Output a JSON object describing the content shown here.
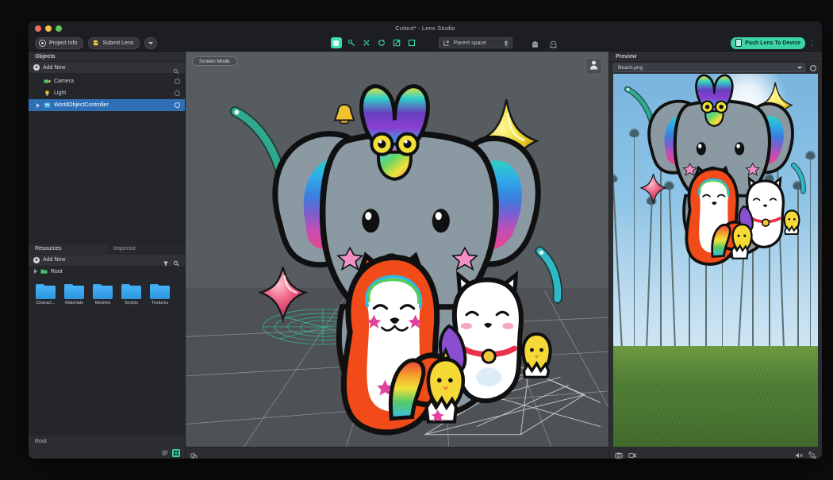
{
  "window": {
    "title": "Cutout* - Lens Studio",
    "traffic_lights": [
      "close",
      "minimize",
      "zoom"
    ]
  },
  "toolbar": {
    "project_info_label": "Project Info",
    "project_info_icon": "lens-studio-logo-icon",
    "submit_lens_label": "Submit Lens",
    "submit_lens_icon": "ghost-icon",
    "submit_caret_icon": "chevron-down-icon",
    "tools": [
      {
        "name": "select-tool",
        "icon": "square-filled-icon",
        "active": true
      },
      {
        "name": "pan-tool",
        "icon": "hand-pan-icon",
        "active": false
      },
      {
        "name": "move-tool",
        "icon": "move-arrows-icon",
        "active": false
      },
      {
        "name": "rotate-tool",
        "icon": "rotate-icon",
        "active": false
      },
      {
        "name": "scale-tool",
        "icon": "scale-icon",
        "active": false
      },
      {
        "name": "resize-tool",
        "icon": "bounding-box-icon",
        "active": false
      }
    ],
    "space_selector": {
      "label": "Parent space",
      "icon": "axis-icon",
      "stepper_icon": "stepper-icon"
    },
    "ghost_tools": [
      {
        "name": "ghost-preview-1-icon"
      },
      {
        "name": "ghost-preview-2-icon"
      }
    ],
    "push_button_label": "Push Lens To Device",
    "push_button_icon": "device-phone-icon",
    "push_button_color": "#3bd3a8",
    "overflow_icon": "vertical-dots-icon"
  },
  "objects_panel": {
    "title": "Objects",
    "add_new_label": "Add New",
    "add_new_icon": "plus-circle-icon",
    "search_icon": "search-icon",
    "items": [
      {
        "label": "Camera",
        "icon": "camera-icon",
        "selected": false,
        "expandable": false,
        "visibility_icon": "eye-toggle-icon"
      },
      {
        "label": "Light",
        "icon": "light-bulb-icon",
        "selected": false,
        "expandable": false,
        "visibility_icon": "eye-toggle-icon"
      },
      {
        "label": "WorldObjectController",
        "icon": "object-node-icon",
        "selected": true,
        "expandable": true,
        "visibility_icon": "eye-toggle-icon"
      }
    ],
    "selection_color": "#2f6fb5"
  },
  "resources_panel": {
    "tabs": [
      {
        "label": "Resources",
        "active": true
      },
      {
        "label": "Inspector",
        "active": false
      }
    ],
    "add_new_label": "Add New",
    "add_new_icon": "plus-circle-icon",
    "filter_icon": "funnel-filter-icon",
    "search_icon": "search-icon",
    "root_label": "Root",
    "root_icon": "folder-root-icon",
    "folders": [
      {
        "label": "Charact...",
        "icon": "folder-icon"
      },
      {
        "label": "Materials",
        "icon": "folder-icon"
      },
      {
        "label": "Meshes",
        "icon": "folder-icon"
      },
      {
        "label": "Scripts",
        "icon": "folder-icon"
      },
      {
        "label": "Textures",
        "icon": "folder-icon"
      }
    ],
    "folder_color": "#3ba4ef",
    "breadcrumb": "Root",
    "view_toggles": [
      {
        "name": "list-view-toggle",
        "icon": "list-view-icon",
        "active": false
      },
      {
        "name": "grid-view-toggle",
        "icon": "grid-view-icon",
        "active": true
      }
    ]
  },
  "viewport": {
    "screen_mode_label": "Screen Mode",
    "avatar_icon": "person-silhouette-icon",
    "footer_icon": "layers-toggle-icon",
    "background_color": "#575c60",
    "grid_color": "#d8dce0",
    "selection_ring_color": "#2fd0a6"
  },
  "preview_panel": {
    "title": "Preview",
    "source_value": "Beach.png",
    "source_caret_icon": "chevron-down-icon",
    "refresh_icon": "refresh-icon",
    "footer_left_icons": [
      {
        "name": "snapshot-icon"
      },
      {
        "name": "record-video-icon"
      }
    ],
    "footer_right_icons": [
      {
        "name": "mute-audio-icon"
      },
      {
        "name": "fullscreen-icon"
      }
    ]
  },
  "scene_artwork": {
    "characters": [
      {
        "name": "elephant",
        "colors": [
          "#8b99a3",
          "#2fd0c8",
          "#3aa0ea",
          "#6a5ed0",
          "#d44f9c"
        ]
      },
      {
        "name": "butterfly",
        "colors": [
          "#f2d93a",
          "#2fd0c8",
          "#6a3fc0",
          "#ff4fa0"
        ]
      },
      {
        "name": "fox",
        "colors": [
          "#f04b18",
          "#ffffff"
        ]
      },
      {
        "name": "cat",
        "colors": [
          "#ffffff",
          "#e8324a",
          "#f0c63a"
        ]
      },
      {
        "name": "chick",
        "colors": [
          "#f5d936",
          "#ffffff"
        ]
      }
    ],
    "decorations": [
      {
        "name": "bell",
        "color": "#f0c22e"
      },
      {
        "name": "yellow-sparkle",
        "color": "#f2dd3a"
      },
      {
        "name": "pink-sparkle",
        "color": "#f06a8a"
      },
      {
        "name": "teal-swoosh",
        "color": "#2fa88e"
      },
      {
        "name": "teal-swoosh-2",
        "color": "#2fb8c8"
      }
    ]
  }
}
